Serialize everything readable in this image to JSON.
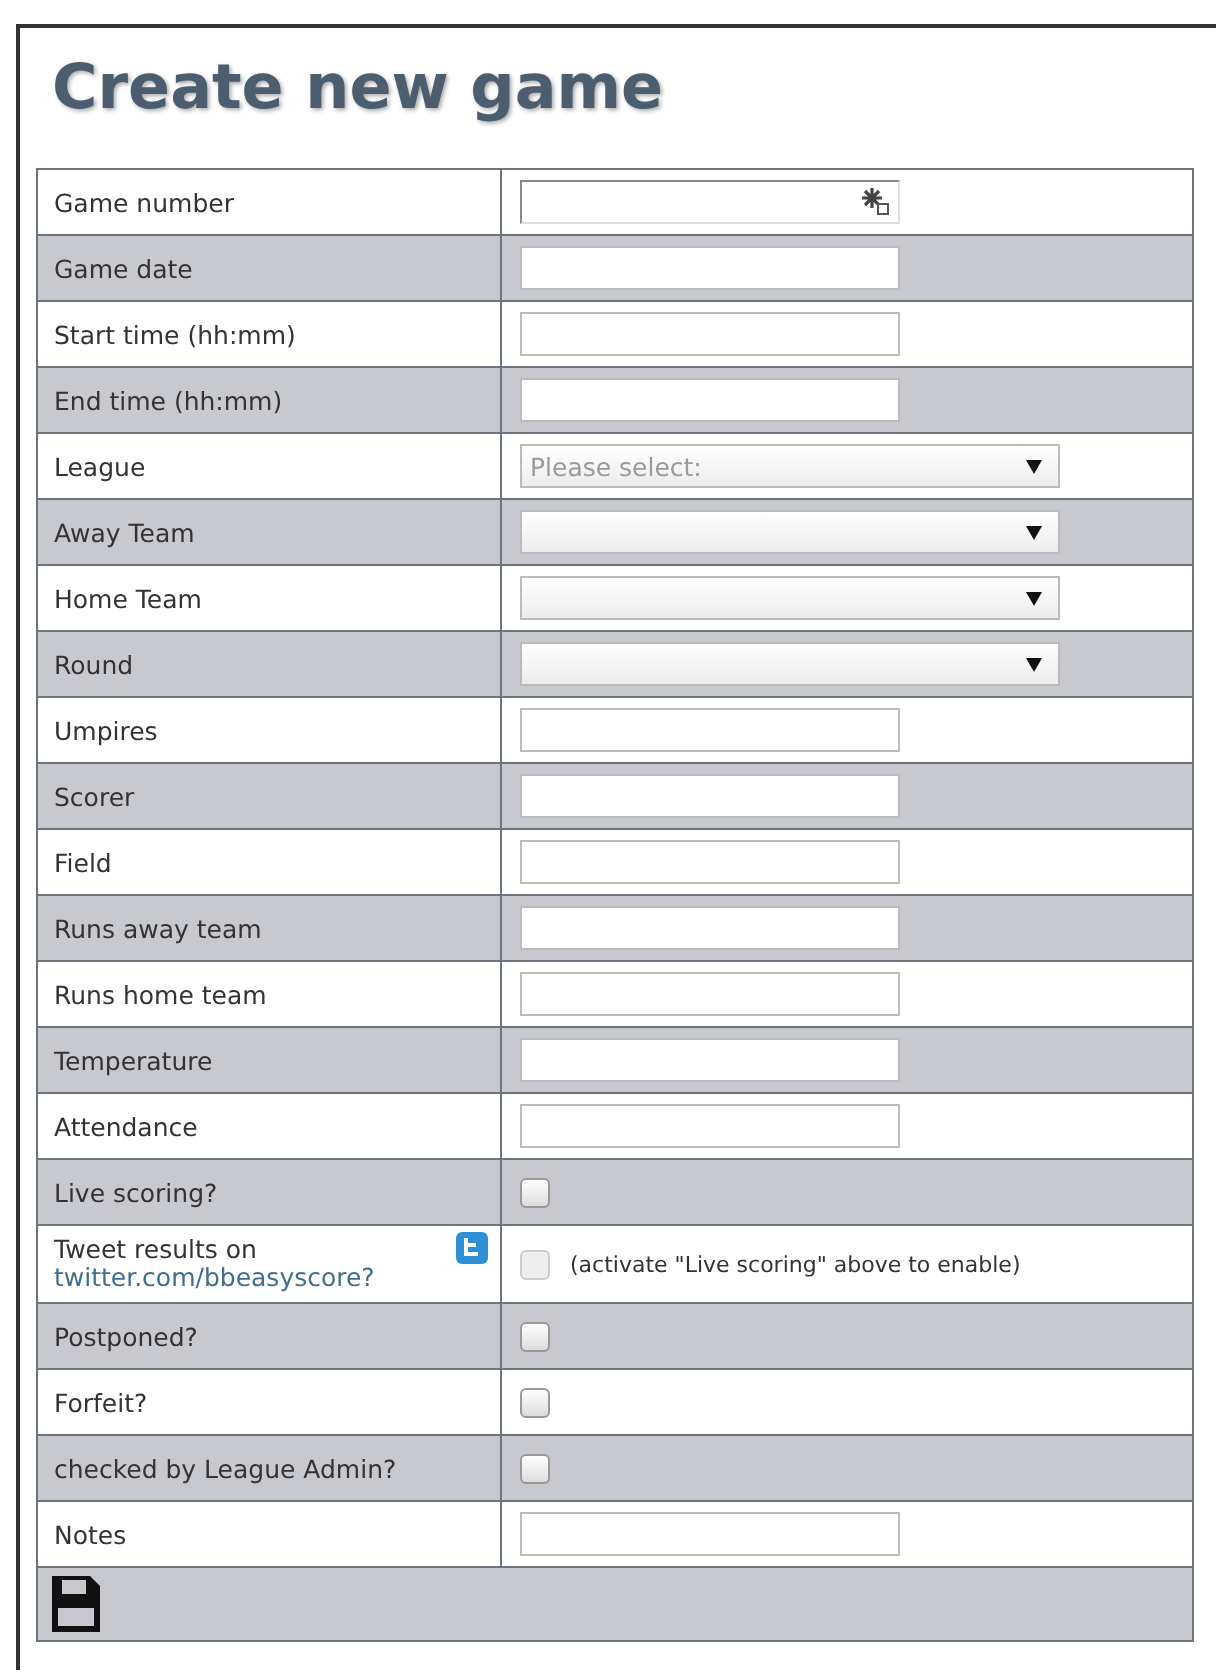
{
  "title": "Create new game",
  "rows": [
    {
      "kind": "text",
      "label": "Game number",
      "icon": true
    },
    {
      "kind": "text",
      "label": "Game date"
    },
    {
      "kind": "text",
      "label": "Start time (hh:mm)"
    },
    {
      "kind": "text",
      "label": "End time (hh:mm)"
    },
    {
      "kind": "select",
      "label": "League",
      "placeholder": "Please select:"
    },
    {
      "kind": "select",
      "label": "Away Team"
    },
    {
      "kind": "select",
      "label": "Home Team"
    },
    {
      "kind": "select",
      "label": "Round"
    },
    {
      "kind": "text",
      "label": "Umpires"
    },
    {
      "kind": "text",
      "label": "Scorer"
    },
    {
      "kind": "text",
      "label": "Field"
    },
    {
      "kind": "text",
      "label": "Runs away team"
    },
    {
      "kind": "text",
      "label": "Runs home team"
    },
    {
      "kind": "text",
      "label": "Temperature"
    },
    {
      "kind": "text",
      "label": "Attendance"
    },
    {
      "kind": "checkbox",
      "label": "Live scoring?",
      "checked": false,
      "disabled": false
    },
    {
      "kind": "tweet",
      "label": "Tweet results on",
      "link": "twitter.com/bbeasyscore?",
      "checked": false,
      "disabled": true,
      "note": "(activate \"Live scoring\" above to enable)"
    },
    {
      "kind": "checkbox",
      "label": "Postponed?",
      "checked": false,
      "disabled": false
    },
    {
      "kind": "checkbox",
      "label": "Forfeit?",
      "checked": false,
      "disabled": false
    },
    {
      "kind": "checkbox",
      "label": "checked by League Admin?",
      "checked": false,
      "disabled": false
    },
    {
      "kind": "text",
      "label": "Notes"
    }
  ]
}
